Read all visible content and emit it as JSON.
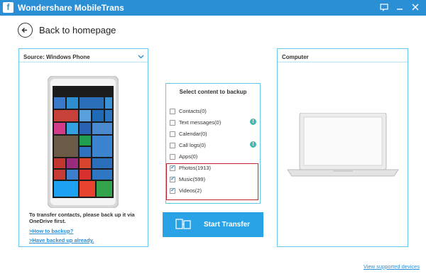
{
  "window": {
    "app_name": "Wondershare MobileTrans",
    "logo_glyph": "f",
    "controls": [
      "chat-icon",
      "minimize-icon",
      "close-icon"
    ]
  },
  "nav": {
    "back_label": "Back to homepage"
  },
  "source": {
    "label": "Source: Windows Phone",
    "note": "To transfer contacts, please back up it via OneDrive first.",
    "link_how": ">How to backup?",
    "link_done": ">Have backed up already."
  },
  "content": {
    "title": "Select content to backup",
    "items": [
      {
        "label": "Contacts(0)",
        "checked": false,
        "info": false
      },
      {
        "label": "Text messages(0)",
        "checked": false,
        "info": true
      },
      {
        "label": "Calendar(0)",
        "checked": false,
        "info": false
      },
      {
        "label": "Call logs(0)",
        "checked": false,
        "info": true
      },
      {
        "label": "Apps(0)",
        "checked": false,
        "info": false
      },
      {
        "label": "Photos(1913)",
        "checked": true,
        "info": false
      },
      {
        "label": "Music(599)",
        "checked": true,
        "info": false
      },
      {
        "label": "Videos(2)",
        "checked": true,
        "info": false
      }
    ],
    "info_glyph": "!",
    "start_label": "Start Transfer"
  },
  "destination": {
    "label": "Computer"
  },
  "footer": {
    "supported_link": "View supported devices"
  },
  "colors": {
    "titlebar": "#2a8fd4",
    "accent": "#2aa3e6",
    "border": "#66c8e8",
    "highlight": "#c0262d",
    "info": "#4ab9ad"
  }
}
